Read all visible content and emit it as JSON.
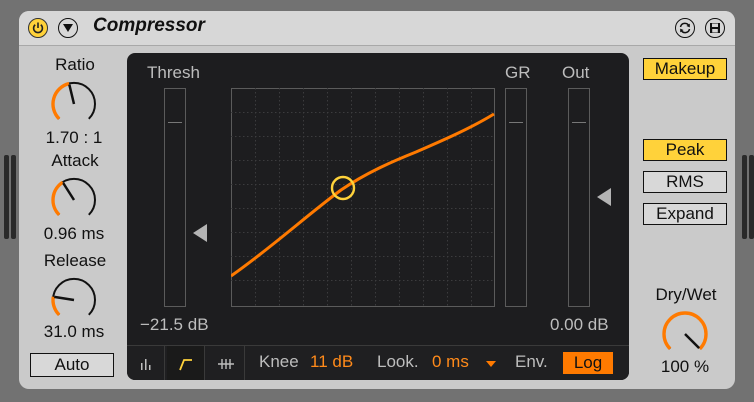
{
  "device": {
    "title": "Compressor",
    "power_on": true
  },
  "knobs": {
    "ratio": {
      "label": "Ratio",
      "value": "1.70 : 1",
      "level": 0.45
    },
    "attack": {
      "label": "Attack",
      "value": "0.96 ms",
      "level": 0.38
    },
    "release": {
      "label": "Release",
      "value": "31.0 ms",
      "level": 0.2
    },
    "drywet": {
      "label": "Dry/Wet",
      "value": "100 %",
      "level": 1.0
    }
  },
  "auto_label": "Auto",
  "display": {
    "thresh_label": "Thresh",
    "gr_label": "GR",
    "out_label": "Out",
    "thresh_value": "−21.5 dB",
    "out_value": "0.00 dB"
  },
  "bottom": {
    "knee_label": "Knee",
    "knee_value": "11 dB",
    "look_label": "Look.",
    "look_value": "0 ms",
    "env_label": "Env.",
    "env_value": "Log"
  },
  "buttons": {
    "makeup": "Makeup",
    "peak": "Peak",
    "rms": "RMS",
    "expand": "Expand"
  },
  "icons": {
    "power": "power-icon",
    "collapse": "triangle-down-icon",
    "hotswap": "hot-swap-icon",
    "save": "save-preset-icon"
  },
  "colors": {
    "accent": "#ffd23a",
    "curve": "#ff7a00",
    "value_orange": "#ff8a1a",
    "display_bg": "#1d1d1f"
  }
}
